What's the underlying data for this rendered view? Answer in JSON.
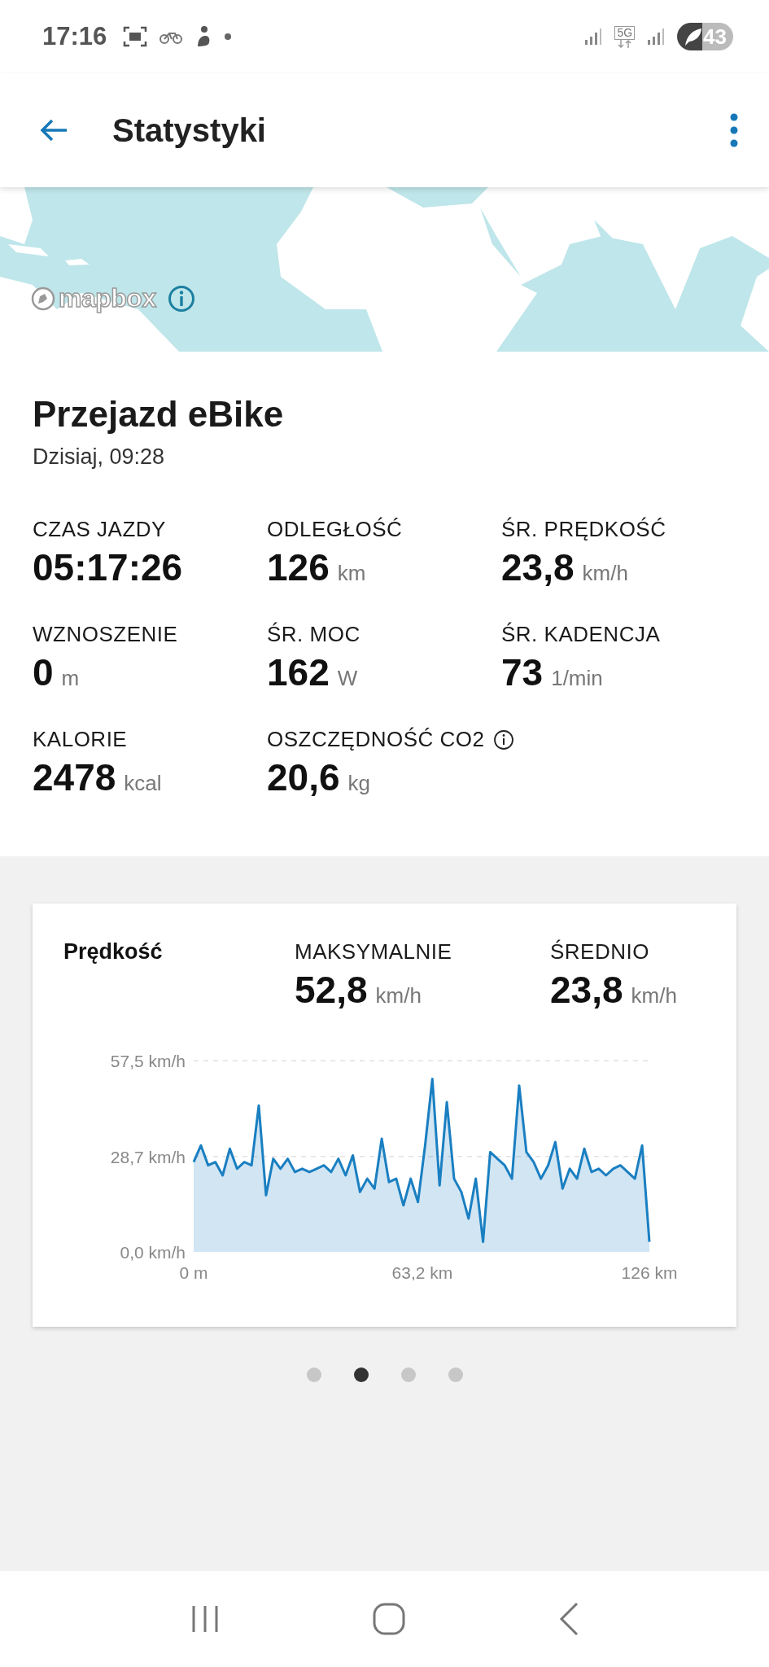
{
  "status_bar": {
    "time": "17:16",
    "network": "5G",
    "battery": "43"
  },
  "app_bar": {
    "title": "Statystyki"
  },
  "map": {
    "kind": "picture",
    "attribution": "mapbox"
  },
  "ride": {
    "title": "Przejazd eBike",
    "date": "Dzisiaj, 09:28"
  },
  "stats": [
    {
      "label": "CZAS JAZDY",
      "value": "05:17:26"
    },
    {
      "label": "ODLEGŁOŚĆ",
      "value": "126",
      "unit": "km"
    },
    {
      "label": "ŚR. PRĘDKOŚĆ",
      "value": "23,8",
      "unit": "km/h"
    },
    {
      "label": "WZNOSZENIE",
      "value": "0",
      "unit": "m"
    },
    {
      "label": "ŚR. MOC",
      "value": "162",
      "unit": "W"
    },
    {
      "label": "ŚR. KADENCJA",
      "value": "73",
      "unit": "1/min"
    },
    {
      "label": "KALORIE",
      "value": "2478",
      "unit": "kcal"
    },
    {
      "label": "OSZCZĘDNOŚĆ CO2",
      "value": "20,6",
      "unit": "kg",
      "info": true
    }
  ],
  "speed_card": {
    "title": "Prędkość",
    "summary": [
      {
        "label": "MAKSYMALNIE",
        "value": "52,8",
        "unit": "km/h"
      },
      {
        "label": "ŚREDNIO",
        "value": "23,8",
        "unit": "km/h"
      }
    ],
    "chart_data": {
      "type": "area",
      "xlim": [
        0,
        126
      ],
      "ylim": [
        0,
        57.5
      ],
      "xticks": [
        {
          "value": 0,
          "label": "0 m"
        },
        {
          "value": 63.2,
          "label": "63,2 km"
        },
        {
          "value": 126,
          "label": "126 km"
        }
      ],
      "yticks": [
        {
          "value": 0,
          "label": "0,0 km/h"
        },
        {
          "value": 28.7,
          "label": "28,7 km/h"
        },
        {
          "value": 57.5,
          "label": "57,5 km/h"
        }
      ],
      "x": [
        0,
        2,
        4,
        6,
        8,
        10,
        12,
        14,
        16,
        18,
        20,
        22,
        24,
        26,
        28,
        30,
        32,
        34,
        36,
        38,
        40,
        42,
        44,
        46,
        48,
        50,
        52,
        54,
        56,
        58,
        60,
        62,
        64,
        66,
        68,
        70,
        72,
        74,
        76,
        78,
        80,
        82,
        84,
        86,
        88,
        90,
        92,
        94,
        96,
        98,
        100,
        102,
        104,
        106,
        108,
        110,
        112,
        114,
        116,
        118,
        120,
        122,
        124,
        126
      ],
      "series": [
        {
          "color": "#1a7fc1",
          "values": [
            27,
            32,
            26,
            27,
            23,
            31,
            25,
            27,
            26,
            44,
            17,
            28,
            25,
            28,
            24,
            25,
            24,
            25,
            26,
            24,
            28,
            23,
            29,
            18,
            22,
            19,
            34,
            21,
            22,
            14,
            22,
            15,
            32,
            52,
            20,
            45,
            22,
            18,
            10,
            22,
            3,
            30,
            28,
            26,
            22,
            50,
            30,
            27,
            22,
            26,
            33,
            19,
            25,
            22,
            31,
            24,
            25,
            23,
            25,
            26,
            24,
            22,
            32,
            3
          ]
        }
      ]
    }
  },
  "pager": [
    {
      "selected": false
    },
    {
      "selected": true
    },
    {
      "selected": false
    },
    {
      "selected": false
    }
  ]
}
